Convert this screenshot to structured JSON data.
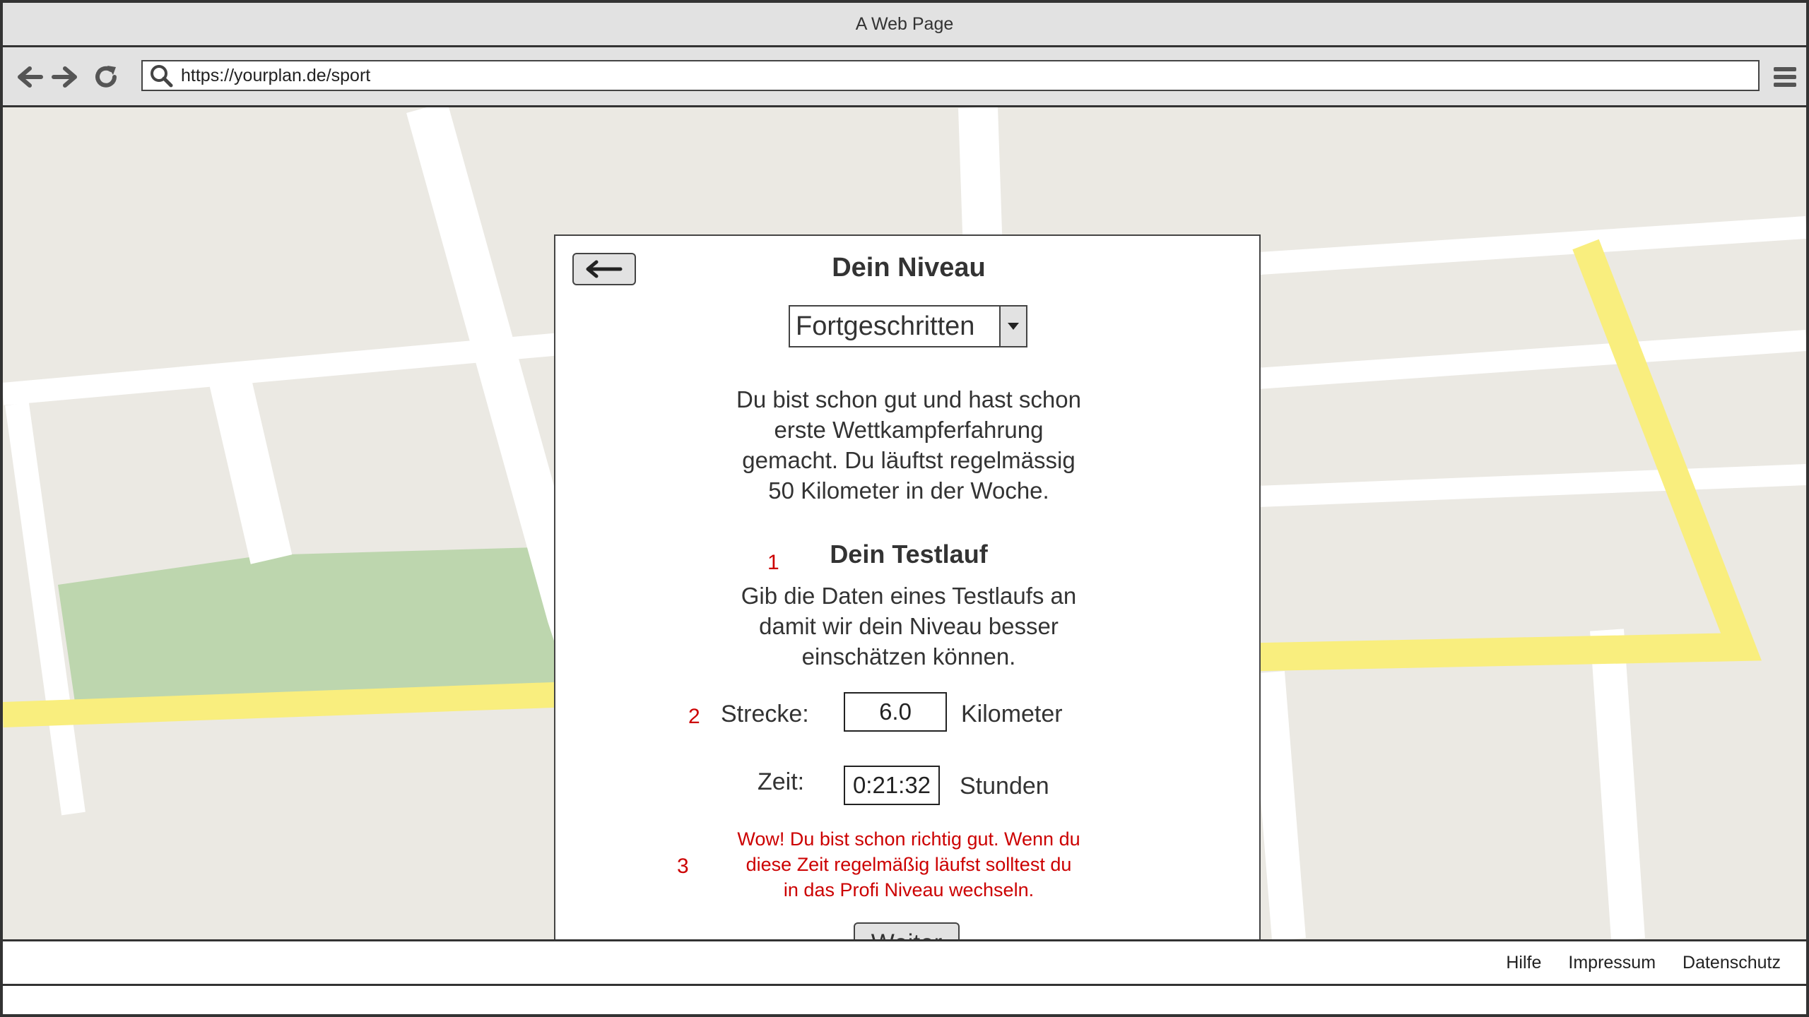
{
  "window": {
    "title": "A Web Page"
  },
  "browser": {
    "url": "https://yourplan.de/sport",
    "icons": [
      "arrow-left-icon",
      "arrow-right-icon",
      "reload-icon",
      "search-icon",
      "hamburger-menu-icon"
    ]
  },
  "colors": {
    "chrome_bg": "#e2e2e2",
    "map_bg": "#ebe9e3",
    "map_road": "#ffffff",
    "map_highlight_road": "#f9ee7e",
    "map_park": "#bdd6ae",
    "error_text": "#cc0000"
  },
  "dialog": {
    "title": "Dein Niveau",
    "level_select": {
      "selected": "Fortgeschritten"
    },
    "description_lines": [
      "Du bist schon gut und hast schon",
      "erste Wettkampferfahrung",
      "gemacht. Du läuftst regelmässig",
      "50 Kilometer in der Woche."
    ],
    "test_run": {
      "marker": "1",
      "title": "Dein Testlauf",
      "instructions_lines": [
        "Gib die Daten eines Testlaufs an",
        "damit wir dein Niveau besser",
        "einschätzen können."
      ]
    },
    "distance": {
      "marker": "2",
      "label": "Strecke:",
      "value": "6.0",
      "unit": "Kilometer"
    },
    "time": {
      "label": "Zeit:",
      "value": "0:21:32",
      "unit": "Stunden"
    },
    "feedback": {
      "marker": "3",
      "lines": [
        "Wow! Du bist schon richtig gut. Wenn du",
        "diese Zeit regelmäßig läufst solltest du",
        "in das Profi Niveau wechseln."
      ]
    },
    "next_button": "Weiter"
  },
  "footer": {
    "links": [
      "Hilfe",
      "Impressum",
      "Datenschutz"
    ]
  }
}
